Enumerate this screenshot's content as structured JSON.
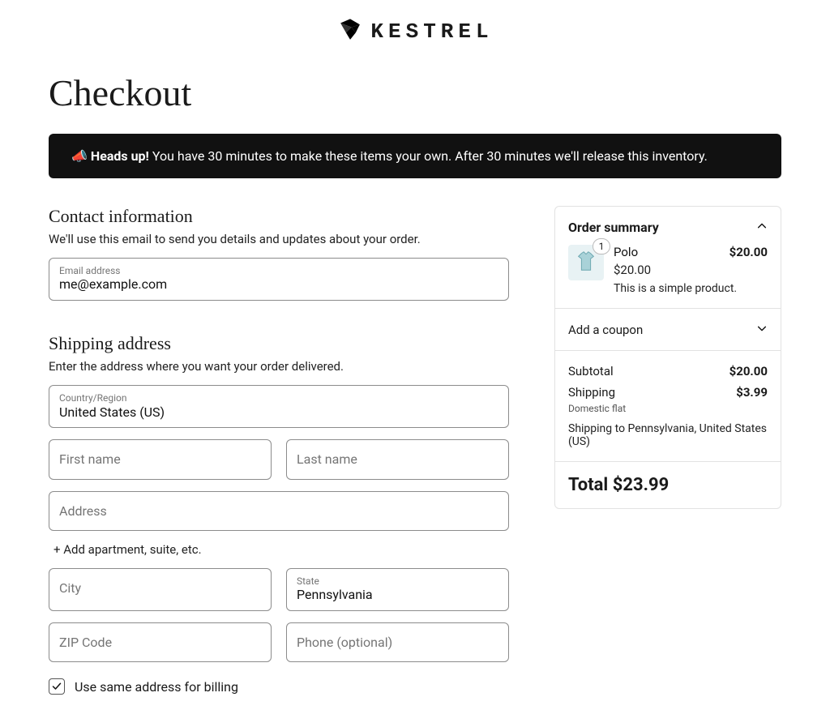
{
  "brand": {
    "name": "KESTREL"
  },
  "page_title": "Checkout",
  "alert": {
    "emoji": "📣",
    "strong": "Heads up!",
    "text": " You have 30 minutes to make these items your own. After 30 minutes we'll release this inventory."
  },
  "contact": {
    "heading": "Contact information",
    "sub": "We'll use this email to send you details and updates about your order.",
    "email_label": "Email address",
    "email_value": "me@example.com"
  },
  "shipping": {
    "heading": "Shipping address",
    "sub": "Enter the address where you want your order delivered.",
    "country_label": "Country/Region",
    "country_value": "United States (US)",
    "first_name_placeholder": "First name",
    "last_name_placeholder": "Last name",
    "address_placeholder": "Address",
    "add_apartment": "+ Add apartment, suite, etc.",
    "city_placeholder": "City",
    "state_label": "State",
    "state_value": "Pennsylvania",
    "zip_placeholder": "ZIP Code",
    "phone_placeholder": "Phone (optional)",
    "billing_checkbox": "Use same address for billing",
    "billing_checked": true
  },
  "summary": {
    "heading": "Order summary",
    "product": {
      "qty": "1",
      "name": "Polo",
      "line_price": "$20.00",
      "unit_price": "$20.00",
      "description": "This is a simple product."
    },
    "coupon_label": "Add a coupon",
    "subtotal_label": "Subtotal",
    "subtotal_value": "$20.00",
    "shipping_label": "Shipping",
    "shipping_value": "$3.99",
    "shipping_method": "Domestic flat",
    "shipping_to": "Shipping to Pennsylvania, United States (US)",
    "total_label": "Total",
    "total_value": "$23.99"
  }
}
